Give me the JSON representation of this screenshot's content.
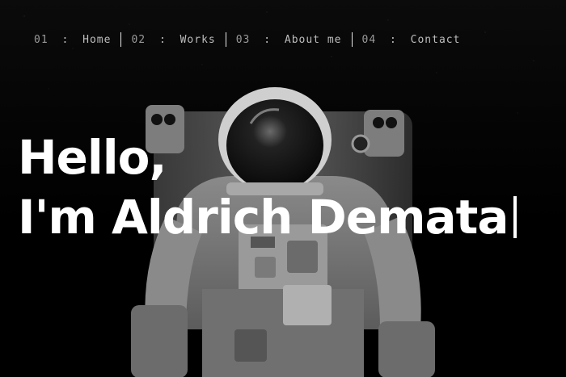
{
  "nav": {
    "items": [
      {
        "num": "01",
        "sep": ":",
        "label": "Home"
      },
      {
        "num": "02",
        "sep": ":",
        "label": "Works"
      },
      {
        "num": "03",
        "sep": ":",
        "label": "About me"
      },
      {
        "num": "04",
        "sep": ":",
        "label": "Contact"
      }
    ]
  },
  "hero": {
    "line1": "Hello,",
    "line2": "I'm Aldrich Demata"
  },
  "colors": {
    "background": "#000000",
    "text": "#ffffff",
    "nav_text": "#bdbdbd"
  },
  "images": {
    "hero_background": "astronaut-photo"
  }
}
